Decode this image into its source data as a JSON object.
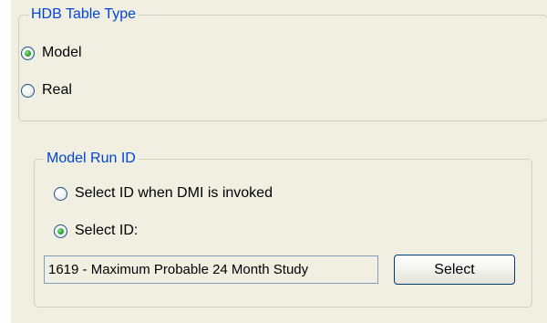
{
  "hdb_table_type": {
    "title": "HDB Table Type",
    "options": [
      {
        "label": "Model",
        "checked": true
      },
      {
        "label": "Real",
        "checked": false
      }
    ]
  },
  "model_run_id": {
    "title": "Model Run ID",
    "options": [
      {
        "label": "Select ID when DMI is invoked",
        "checked": false
      },
      {
        "label": "Select ID:",
        "checked": true
      }
    ],
    "selected_id_value": "1619 - Maximum Probable 24 Month Study",
    "select_button_label": "Select"
  },
  "colors": {
    "panel_background": "#f1efe2",
    "group_title": "#0046d5",
    "group_border": "#d0d0bf",
    "radio_selected_dot": "#2fa82f"
  }
}
